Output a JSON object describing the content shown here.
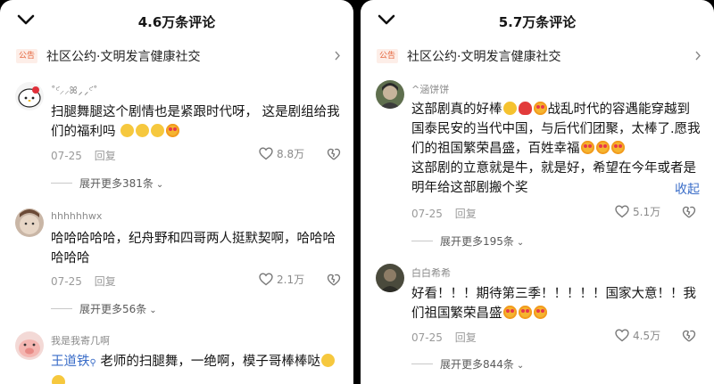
{
  "left": {
    "title": "4.6万条评论",
    "notice_tag": "公告",
    "notice_text": "社区公约·文明发言健康社交",
    "comments": [
      {
        "user": "˚ᶜ͘⸝⸝ꕤ⸝⸝ᶜ͘˚",
        "text": "扫腿舞腿这个剧情也是紧跟时代呀， 这是剧组给我们的福利吗",
        "date": "07-25",
        "reply": "回复",
        "likes": "8.8万",
        "expand": "展开更多381条"
      },
      {
        "user": "hhhhhhwx",
        "text": "哈哈哈哈哈，纪舟野和四哥两人挺默契啊，哈哈哈哈哈哈",
        "date": "07-25",
        "reply": "回复",
        "likes": "2.1万",
        "expand": "展开更多56条"
      },
      {
        "user": "我是我寄几啊",
        "mention": "王道铁",
        "text": " 老师的扫腿舞，一绝啊，模子哥棒棒哒",
        "date": "",
        "reply": "",
        "likes": "",
        "expand": ""
      }
    ]
  },
  "right": {
    "title": "5.7万条评论",
    "notice_tag": "公告",
    "notice_text": "社区公约·文明发言健康社交",
    "comments": [
      {
        "user": "^涵饼饼",
        "text1": "这部剧真的好棒",
        "text2": "战乱时代的容遇能穿越到国泰民安的当代中国，与后代们团聚，太棒了.愿我们的祖国繁荣昌盛，百姓幸福",
        "text3": "这部剧的立意就是牛，就是好，希望在今年或者是明年给这部剧搬个奖",
        "collapse": "收起",
        "date": "07-25",
        "reply": "回复",
        "likes": "5.1万",
        "expand": "展开更多195条"
      },
      {
        "user": "白白希希",
        "text": "好看！！！期待第三季！！！！！国家大意！！我们祖国繁荣昌盛",
        "date": "07-25",
        "reply": "回复",
        "likes": "4.5万",
        "expand": "展开更多844条"
      }
    ]
  },
  "colors": {
    "accent_blue": "#3a6dc8",
    "notice_orange": "#e4633a"
  },
  "icons": [
    "chevron-down-icon",
    "chevron-right-icon",
    "heart-icon",
    "dislike-icon"
  ]
}
